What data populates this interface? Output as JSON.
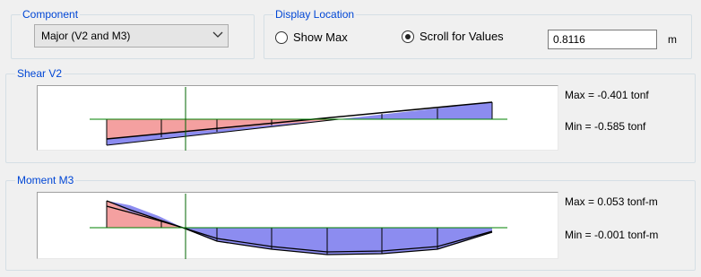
{
  "component": {
    "title": "Component",
    "selected": "Major (V2 and M3)",
    "dropdown_icon": "chevron-down-icon"
  },
  "display_location": {
    "title": "Display Location",
    "options": [
      {
        "label": "Show Max",
        "checked": false
      },
      {
        "label": "Scroll for Values",
        "checked": true
      }
    ],
    "location_value": "0.8116",
    "unit": "m"
  },
  "shear": {
    "title": "Shear V2",
    "max_text": "Max = -0.401 tonf",
    "min_text": "Min = -0.585 tonf"
  },
  "moment": {
    "title": "Moment M3",
    "max_text": "Max = 0.053 tonf-m",
    "min_text": "Min = -0.001 tonf-m"
  },
  "colors": {
    "positive_fill": "#f4a0a0",
    "negative_fill": "#8c8cf0",
    "baseline": "#008000",
    "cursor": "#006400",
    "outline": "#000000"
  }
}
